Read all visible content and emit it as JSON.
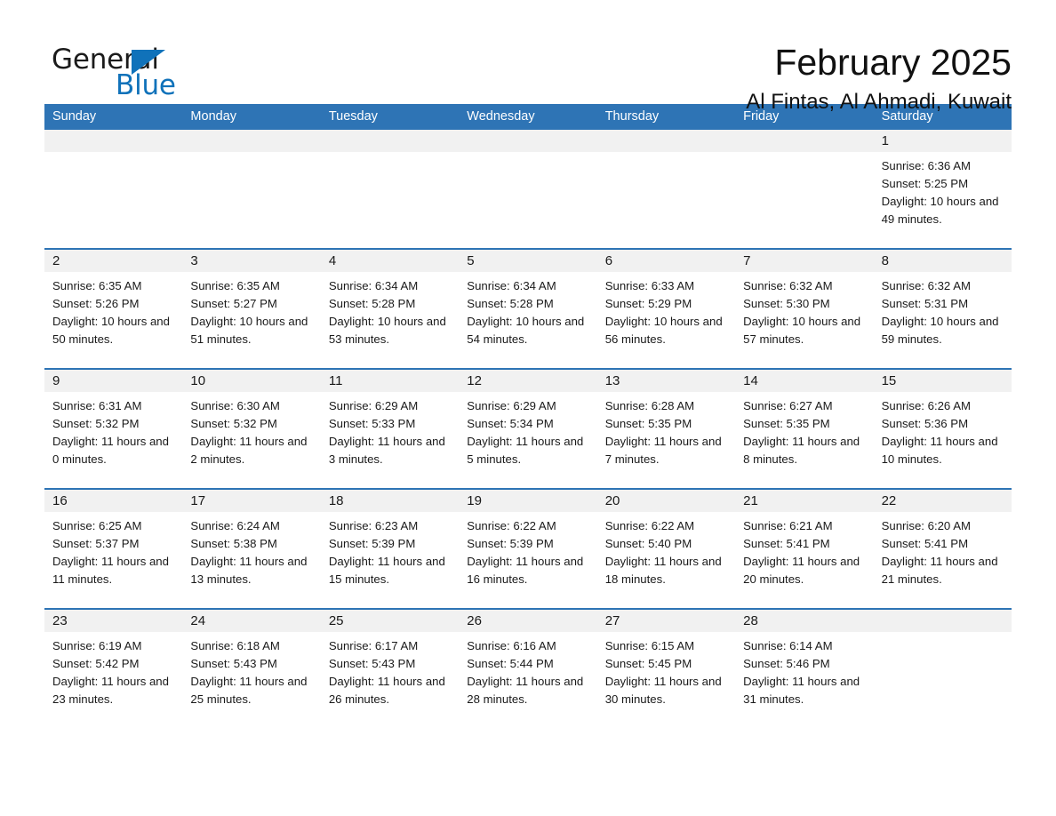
{
  "brand": {
    "name_top": "General",
    "name_bottom": "Blue",
    "triangle_color": "#1072BA",
    "text_color": "#1b1b1b"
  },
  "header": {
    "month_title": "February 2025",
    "location": "Al Fintas, Al Ahmadi, Kuwait"
  },
  "theme": {
    "header_blue": "#2E74B5",
    "day_band_gray": "#F1F1F1",
    "text_color": "#1a1a1a"
  },
  "weekdays": [
    "Sunday",
    "Monday",
    "Tuesday",
    "Wednesday",
    "Thursday",
    "Friday",
    "Saturday"
  ],
  "labels": {
    "sunrise_prefix": "Sunrise:",
    "sunset_prefix": "Sunset:",
    "daylight_prefix": "Daylight:"
  },
  "weeks": [
    [
      {
        "day": "",
        "empty": true
      },
      {
        "day": "",
        "empty": true
      },
      {
        "day": "",
        "empty": true
      },
      {
        "day": "",
        "empty": true
      },
      {
        "day": "",
        "empty": true
      },
      {
        "day": "",
        "empty": true
      },
      {
        "day": "1",
        "sunrise": "Sunrise: 6:36 AM",
        "sunset": "Sunset: 5:25 PM",
        "daylight": "Daylight: 10 hours and 49 minutes."
      }
    ],
    [
      {
        "day": "2",
        "sunrise": "Sunrise: 6:35 AM",
        "sunset": "Sunset: 5:26 PM",
        "daylight": "Daylight: 10 hours and 50 minutes."
      },
      {
        "day": "3",
        "sunrise": "Sunrise: 6:35 AM",
        "sunset": "Sunset: 5:27 PM",
        "daylight": "Daylight: 10 hours and 51 minutes."
      },
      {
        "day": "4",
        "sunrise": "Sunrise: 6:34 AM",
        "sunset": "Sunset: 5:28 PM",
        "daylight": "Daylight: 10 hours and 53 minutes."
      },
      {
        "day": "5",
        "sunrise": "Sunrise: 6:34 AM",
        "sunset": "Sunset: 5:28 PM",
        "daylight": "Daylight: 10 hours and 54 minutes."
      },
      {
        "day": "6",
        "sunrise": "Sunrise: 6:33 AM",
        "sunset": "Sunset: 5:29 PM",
        "daylight": "Daylight: 10 hours and 56 minutes."
      },
      {
        "day": "7",
        "sunrise": "Sunrise: 6:32 AM",
        "sunset": "Sunset: 5:30 PM",
        "daylight": "Daylight: 10 hours and 57 minutes."
      },
      {
        "day": "8",
        "sunrise": "Sunrise: 6:32 AM",
        "sunset": "Sunset: 5:31 PM",
        "daylight": "Daylight: 10 hours and 59 minutes."
      }
    ],
    [
      {
        "day": "9",
        "sunrise": "Sunrise: 6:31 AM",
        "sunset": "Sunset: 5:32 PM",
        "daylight": "Daylight: 11 hours and 0 minutes."
      },
      {
        "day": "10",
        "sunrise": "Sunrise: 6:30 AM",
        "sunset": "Sunset: 5:32 PM",
        "daylight": "Daylight: 11 hours and 2 minutes."
      },
      {
        "day": "11",
        "sunrise": "Sunrise: 6:29 AM",
        "sunset": "Sunset: 5:33 PM",
        "daylight": "Daylight: 11 hours and 3 minutes."
      },
      {
        "day": "12",
        "sunrise": "Sunrise: 6:29 AM",
        "sunset": "Sunset: 5:34 PM",
        "daylight": "Daylight: 11 hours and 5 minutes."
      },
      {
        "day": "13",
        "sunrise": "Sunrise: 6:28 AM",
        "sunset": "Sunset: 5:35 PM",
        "daylight": "Daylight: 11 hours and 7 minutes."
      },
      {
        "day": "14",
        "sunrise": "Sunrise: 6:27 AM",
        "sunset": "Sunset: 5:35 PM",
        "daylight": "Daylight: 11 hours and 8 minutes."
      },
      {
        "day": "15",
        "sunrise": "Sunrise: 6:26 AM",
        "sunset": "Sunset: 5:36 PM",
        "daylight": "Daylight: 11 hours and 10 minutes."
      }
    ],
    [
      {
        "day": "16",
        "sunrise": "Sunrise: 6:25 AM",
        "sunset": "Sunset: 5:37 PM",
        "daylight": "Daylight: 11 hours and 11 minutes."
      },
      {
        "day": "17",
        "sunrise": "Sunrise: 6:24 AM",
        "sunset": "Sunset: 5:38 PM",
        "daylight": "Daylight: 11 hours and 13 minutes."
      },
      {
        "day": "18",
        "sunrise": "Sunrise: 6:23 AM",
        "sunset": "Sunset: 5:39 PM",
        "daylight": "Daylight: 11 hours and 15 minutes."
      },
      {
        "day": "19",
        "sunrise": "Sunrise: 6:22 AM",
        "sunset": "Sunset: 5:39 PM",
        "daylight": "Daylight: 11 hours and 16 minutes."
      },
      {
        "day": "20",
        "sunrise": "Sunrise: 6:22 AM",
        "sunset": "Sunset: 5:40 PM",
        "daylight": "Daylight: 11 hours and 18 minutes."
      },
      {
        "day": "21",
        "sunrise": "Sunrise: 6:21 AM",
        "sunset": "Sunset: 5:41 PM",
        "daylight": "Daylight: 11 hours and 20 minutes."
      },
      {
        "day": "22",
        "sunrise": "Sunrise: 6:20 AM",
        "sunset": "Sunset: 5:41 PM",
        "daylight": "Daylight: 11 hours and 21 minutes."
      }
    ],
    [
      {
        "day": "23",
        "sunrise": "Sunrise: 6:19 AM",
        "sunset": "Sunset: 5:42 PM",
        "daylight": "Daylight: 11 hours and 23 minutes."
      },
      {
        "day": "24",
        "sunrise": "Sunrise: 6:18 AM",
        "sunset": "Sunset: 5:43 PM",
        "daylight": "Daylight: 11 hours and 25 minutes."
      },
      {
        "day": "25",
        "sunrise": "Sunrise: 6:17 AM",
        "sunset": "Sunset: 5:43 PM",
        "daylight": "Daylight: 11 hours and 26 minutes."
      },
      {
        "day": "26",
        "sunrise": "Sunrise: 6:16 AM",
        "sunset": "Sunset: 5:44 PM",
        "daylight": "Daylight: 11 hours and 28 minutes."
      },
      {
        "day": "27",
        "sunrise": "Sunrise: 6:15 AM",
        "sunset": "Sunset: 5:45 PM",
        "daylight": "Daylight: 11 hours and 30 minutes."
      },
      {
        "day": "28",
        "sunrise": "Sunrise: 6:14 AM",
        "sunset": "Sunset: 5:46 PM",
        "daylight": "Daylight: 11 hours and 31 minutes."
      },
      {
        "day": "",
        "empty": true
      }
    ]
  ]
}
